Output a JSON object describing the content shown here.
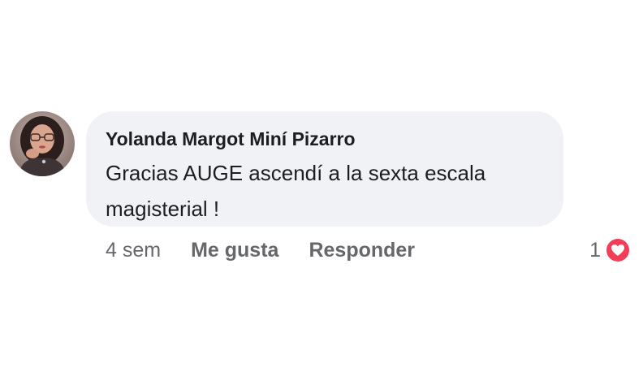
{
  "comment": {
    "author": "Yolanda Margot Miní Pizarro",
    "text": "Gracias AUGE ascendí a la sexta escala magisterial !",
    "timestamp": "4 sem",
    "like_label": "Me gusta",
    "reply_label": "Responder",
    "reaction_count": "1",
    "reaction_type": "heart-icon"
  },
  "colors": {
    "bubble_bg": "#f0f2f5",
    "text_primary": "#1c1e21",
    "text_secondary": "#65676b",
    "love_reaction": "#f33e58"
  }
}
